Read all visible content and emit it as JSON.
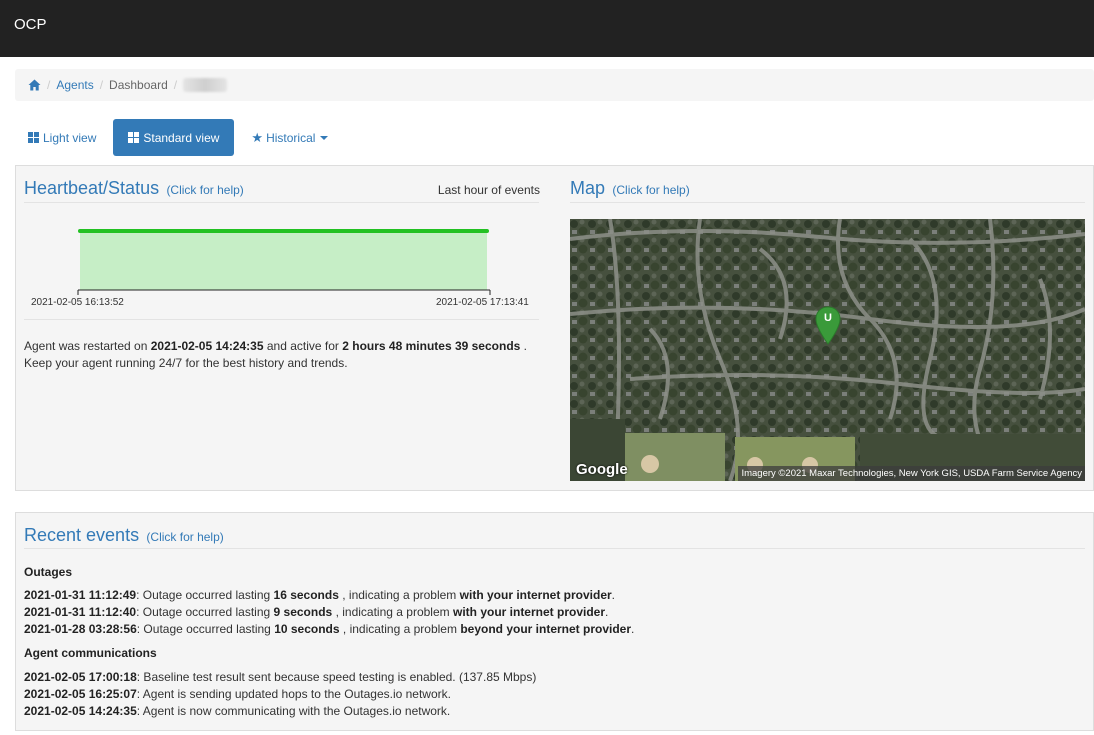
{
  "app": {
    "brand": "OCP"
  },
  "breadcrumb": {
    "agents": "Agents",
    "dashboard": "Dashboard"
  },
  "views": {
    "light": "Light view",
    "standard": "Standard view",
    "historical": "Historical"
  },
  "heartbeat": {
    "title": "Heartbeat/Status",
    "help": "(Click for help)",
    "range_label": "Last hour of events",
    "start_time": "2021-02-05 16:13:52",
    "end_time": "2021-02-05 17:13:41",
    "status_color": "#22c122",
    "fill_color": "#c6eec6",
    "uptime_fraction": 1.0,
    "msg_pre": "Agent was restarted on",
    "restart_time": "2021-02-05 14:24:35",
    "msg_mid": "and active for",
    "active_for": "2 hours 48 minutes 39 seconds",
    "msg_end": ".",
    "msg_line2": "Keep your agent running 24/7 for the best history and trends."
  },
  "map": {
    "title": "Map",
    "help": "(Click for help)",
    "marker_label": "U",
    "marker_color": "#3a9a3a",
    "logo": "Google",
    "attribution": "Imagery ©2021 Maxar Technologies, New York GIS, USDA Farm Service Agency"
  },
  "events": {
    "title": "Recent events",
    "help": "(Click for help)",
    "outages_heading": "Outages",
    "outages": [
      {
        "time": "2021-01-31 11:12:49",
        "pre": ": Outage occurred lasting",
        "duration": "16 seconds",
        "mid": ", indicating a problem",
        "where": "with your internet provider",
        "end": "."
      },
      {
        "time": "2021-01-31 11:12:40",
        "pre": ": Outage occurred lasting",
        "duration": "9 seconds",
        "mid": ", indicating a problem",
        "where": "with your internet provider",
        "end": "."
      },
      {
        "time": "2021-01-28 03:28:56",
        "pre": ": Outage occurred lasting",
        "duration": "10 seconds",
        "mid": ", indicating a problem",
        "where": "beyond your internet provider",
        "end": "."
      }
    ],
    "comms_heading": "Agent communications",
    "comms": [
      {
        "time": "2021-02-05 17:00:18",
        "text": ": Baseline test result sent because speed testing is enabled. (137.85 Mbps)"
      },
      {
        "time": "2021-02-05 16:25:07",
        "text": ": Agent is sending updated hops to the Outages.io network."
      },
      {
        "time": "2021-02-05 14:24:35",
        "text": ": Agent is now communicating with the Outages.io network."
      }
    ]
  }
}
